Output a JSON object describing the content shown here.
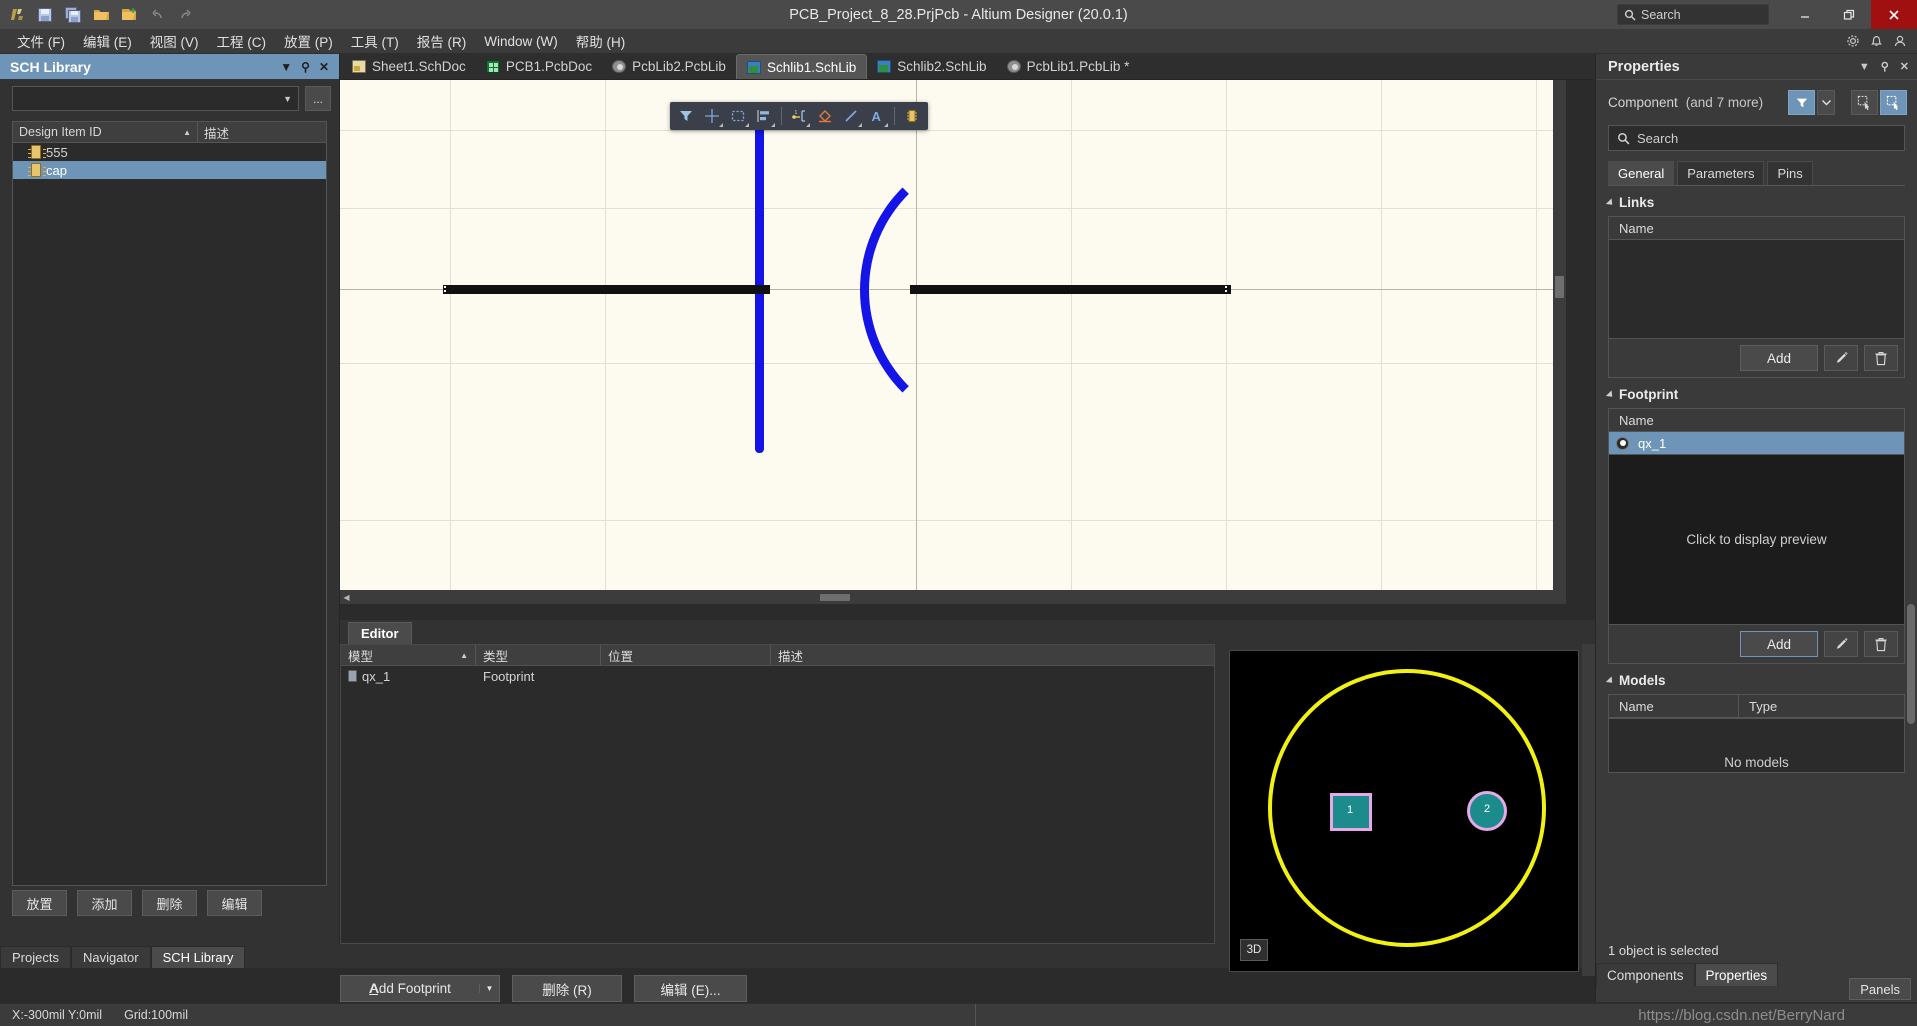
{
  "window": {
    "title": "PCB_Project_8_28.PrjPcb - Altium Designer (20.0.1)",
    "search_placeholder": "Search",
    "minimize_label": "–",
    "restore_label": "❐",
    "close_label": "✕"
  },
  "quick_access": [
    {
      "name": "altium-logo-icon",
      "label": "A"
    },
    {
      "name": "save-icon",
      "label": "Save"
    },
    {
      "name": "save-all-icon",
      "label": "Save All"
    },
    {
      "name": "open-icon",
      "label": "Open"
    },
    {
      "name": "open-project-icon",
      "label": "Open Project"
    },
    {
      "name": "undo-icon",
      "label": "Undo"
    },
    {
      "name": "redo-icon",
      "label": "Redo"
    }
  ],
  "menubar": {
    "items": [
      {
        "label": "文件 (F)"
      },
      {
        "label": "编辑 (E)"
      },
      {
        "label": "视图 (V)"
      },
      {
        "label": "工程 (C)"
      },
      {
        "label": "放置 (P)"
      },
      {
        "label": "工具 (T)"
      },
      {
        "label": "报告 (R)"
      },
      {
        "label": "Window (W)"
      },
      {
        "label": "帮助 (H)"
      }
    ],
    "right_icons": [
      "gear-icon",
      "bell-icon",
      "user-icon"
    ]
  },
  "sch_library": {
    "panel_title": "SCH Library",
    "library_combo_value": "",
    "ellipsis_label": "...",
    "columns": [
      "Design Item ID",
      "描述"
    ],
    "rows": [
      {
        "id": "555",
        "desc": "",
        "selected": false
      },
      {
        "id": "cap",
        "desc": "",
        "selected": true
      }
    ],
    "buttons": [
      {
        "label": "放置"
      },
      {
        "label": "添加"
      },
      {
        "label": "删除"
      },
      {
        "label": "编辑"
      }
    ],
    "bottom_tabs": [
      {
        "label": "Projects",
        "active": false
      },
      {
        "label": "Navigator",
        "active": false
      },
      {
        "label": "SCH Library",
        "active": true
      }
    ]
  },
  "doc_tabs": [
    {
      "label": "Sheet1.SchDoc",
      "icon": "sch-doc-icon",
      "type": "sch",
      "active": false
    },
    {
      "label": "PCB1.PcbDoc",
      "icon": "pcb-doc-icon",
      "type": "pcb",
      "active": false
    },
    {
      "label": "PcbLib2.PcbLib",
      "icon": "pcb-lib-icon",
      "type": "pcblib",
      "active": false
    },
    {
      "label": "Schlib1.SchLib",
      "icon": "sch-lib-icon",
      "type": "schlib",
      "active": true
    },
    {
      "label": "Schlib2.SchLib",
      "icon": "sch-lib-icon",
      "type": "schlib",
      "active": false
    },
    {
      "label": "PcbLib1.PcbLib *",
      "icon": "pcb-lib-icon",
      "type": "pcblib",
      "active": false
    }
  ],
  "canvas_toolbar": [
    {
      "name": "filter-icon",
      "label": "Filter"
    },
    {
      "name": "crosshair-place-icon",
      "label": "Place"
    },
    {
      "name": "selection-rect-icon",
      "label": "Selection"
    },
    {
      "name": "align-icon",
      "label": "Align"
    },
    {
      "name": "place-pin-icon",
      "label": "Place Pin"
    },
    {
      "name": "place-polygon-icon",
      "label": "Place Polygon"
    },
    {
      "name": "place-line-icon",
      "label": "Place Line"
    },
    {
      "name": "place-text-icon",
      "label": "Place Text"
    },
    {
      "name": "place-component-icon",
      "label": "Place Component"
    }
  ],
  "editor_panel": {
    "tab_label": "Editor",
    "columns": [
      "模型",
      "类型",
      "位置",
      "描述"
    ],
    "rows": [
      {
        "model": "qx_1",
        "type": "Footprint",
        "location": "",
        "description": ""
      }
    ],
    "buttons": {
      "add_footprint": "Add Footprint",
      "add_footprint_accel": "A",
      "delete": "删除 (R)",
      "edit": "编辑 (E)..."
    }
  },
  "preview_3d": {
    "badge": "3D",
    "pad_labels": [
      "1",
      "2"
    ],
    "outline_color": "#f2f212",
    "pad_fill_color": "#1c8b8b",
    "pad_ring_color": "#e6a8e6"
  },
  "properties": {
    "panel_title": "Properties",
    "object_type": "Component",
    "more_count": "(and 7 more)",
    "search_placeholder": "Search",
    "tabs": [
      {
        "label": "General",
        "active": true
      },
      {
        "label": "Parameters",
        "active": false
      },
      {
        "label": "Pins",
        "active": false
      }
    ],
    "sections": {
      "links": {
        "title": "Links",
        "column": "Name",
        "rows": [],
        "add_label": "Add"
      },
      "footprint": {
        "title": "Footprint",
        "column": "Name",
        "rows": [
          {
            "name": "qx_1",
            "selected": true
          }
        ],
        "preview_text": "Click to display preview",
        "add_label": "Add"
      },
      "models": {
        "title": "Models",
        "columns": [
          "Name",
          "Type"
        ],
        "empty_text": "No models"
      }
    },
    "status": "1 object is selected",
    "bottom_tabs": [
      {
        "label": "Components",
        "active": false
      },
      {
        "label": "Properties",
        "active": true
      }
    ]
  },
  "statusbar": {
    "coordinates": "X:-300mil Y:0mil",
    "grid": "Grid:100mil",
    "panels_button": "Panels",
    "watermark": "https://blog.csdn.net/BerryNard"
  },
  "colors": {
    "accent_blue": "#6e95b8",
    "symbol_blue": "#1414e6",
    "pin_black": "#111111",
    "canvas_bg": "#fdfbf0",
    "close_red": "#a01010"
  }
}
